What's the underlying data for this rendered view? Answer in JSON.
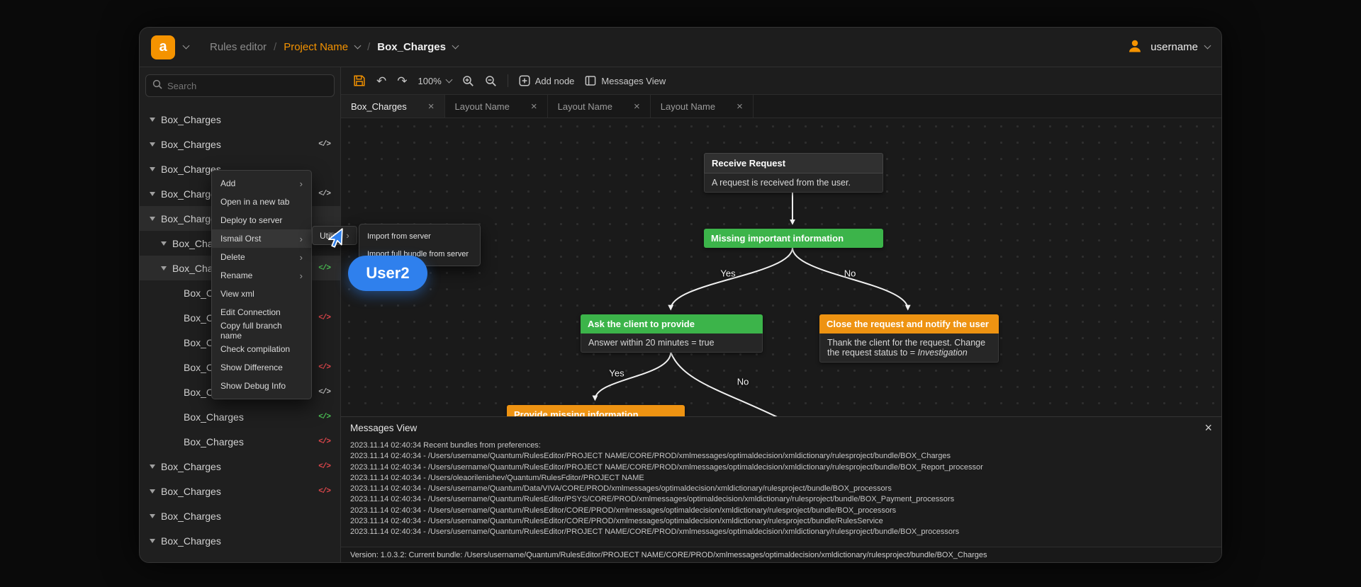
{
  "header": {
    "logo_text": "a",
    "breadcrumb": {
      "app": "Rules editor",
      "sep": "/",
      "project": "Project Name",
      "file": "Box_Charges"
    },
    "user": {
      "name": "username"
    }
  },
  "sidebar": {
    "search_placeholder": "Search",
    "tree": [
      {
        "label": "Box_Charges",
        "icon": "none"
      },
      {
        "label": "Box_Charges",
        "icon": "code-gray"
      },
      {
        "label": "Box_Charges",
        "icon": "none"
      },
      {
        "label": "Box_Charges",
        "icon": "code-gray"
      },
      {
        "label": "Box_Charges",
        "icon": "none",
        "selected": true
      },
      {
        "label": "Box_Charges",
        "icon": "none"
      },
      {
        "label": "Box_Charges",
        "icon": "code-green",
        "selected": true
      },
      {
        "label": "Box_Charges",
        "icon": "none"
      },
      {
        "label": "Box_Charges",
        "icon": "code-red"
      },
      {
        "label": "Box_Charges",
        "icon": "none"
      },
      {
        "label": "Box_Charges",
        "icon": "code-red"
      },
      {
        "label": "Box_Charges",
        "icon": "code-gray"
      },
      {
        "label": "Box_Charges",
        "icon": "code-green"
      },
      {
        "label": "Box_Charges",
        "icon": "code-red"
      },
      {
        "label": "Box_Charges",
        "icon": "code-red"
      },
      {
        "label": "Box_Charges",
        "icon": "code-red"
      },
      {
        "label": "Box_Charges",
        "icon": "none"
      },
      {
        "label": "Box_Charges",
        "icon": "none"
      }
    ]
  },
  "context_menu": {
    "items": [
      {
        "label": "Add",
        "has_submenu": true
      },
      {
        "label": "Open in a new tab"
      },
      {
        "label": "Deploy to server"
      },
      {
        "label": "Ismail Orst",
        "has_submenu": true,
        "active": true
      },
      {
        "label": "Delete",
        "has_submenu": true
      },
      {
        "label": "Rename",
        "has_submenu": true
      },
      {
        "label": "View xml"
      },
      {
        "label": "Edit Connection"
      },
      {
        "label": "Copy full branch name"
      },
      {
        "label": "Check compilation"
      },
      {
        "label": "Show Difference"
      },
      {
        "label": "Show Debug Info"
      }
    ],
    "utility_label": "Utility",
    "submenu_items": [
      "Import from server",
      "Import full bundle from server"
    ]
  },
  "collaborator": {
    "name": "User2",
    "color": "#2F80ED"
  },
  "toolbar": {
    "zoom_level": "100%",
    "add_node": "Add node",
    "messages_view": "Messages View"
  },
  "tabs": [
    {
      "label": "Box_Charges",
      "active": true
    },
    {
      "label": "Layout Name",
      "active": false
    },
    {
      "label": "Layout Name",
      "active": false
    },
    {
      "label": "Layout Name",
      "active": false
    }
  ],
  "canvas": {
    "nodes": {
      "receive": {
        "title": "Receive Request",
        "body": "A request is received from the user."
      },
      "missing": {
        "title": "Missing important information"
      },
      "ask": {
        "title": "Ask the client to provide",
        "body": "Answer within 20 minutes = true"
      },
      "close": {
        "title": "Close the request and notify the user",
        "body": "Thank the client for the request. Change the request status to = ",
        "body_em": "Investigation"
      },
      "provide": {
        "title": "Provide missing information"
      }
    },
    "edge_labels": {
      "l1": "Yes",
      "l2": "No",
      "l3": "Yes",
      "l4": "No"
    }
  },
  "messages": {
    "title": "Messages View",
    "lines": [
      "2023.11.14 02:40:34 Recent bundles from preferences:",
      "2023.11.14 02:40:34 - /Users/username/Quantum/RulesEditor/PROJECT NAME/CORE/PROD/xmlmessages/optimaldecision/xmldictionary/rulesproject/bundle/BOX_Charges",
      "2023.11.14 02:40:34 - /Users/username/Quantum/RulesEditor/PROJECT NAME/CORE/PROD/xmlmessages/optimaldecision/xmldictionary/rulesproject/bundle/BOX_Report_processor",
      "2023.11.14 02:40:34 - /Users/oleaorilenishev/Quantum/RulesFditor/PROJECT NAME",
      "2023.11.14 02:40:34 - /Users/username/Quantum/Data/VIVA/CORE/PROD/xmlmessages/optimaldecision/xmldictionary/rulesproject/bundle/BOX_processors",
      "2023.11.14 02:40:34 - /Users/username/Quantum/RulesEditor/PSYS/CORE/PROD/xmlmessages/optimaldecision/xmldictionary/rulesproject/bundle/BOX_Payment_processors",
      "2023.11.14 02:40:34 - /Users/username/Quantum/RulesEditor/CORE/PROD/xmlmessages/optimaldecision/xmldictionary/rulesproject/bundle/BOX_processors",
      "2023.11.14 02:40:34 - /Users/username/Quantum/RulesEditor/CORE/PROD/xmlmessages/optimaldecision/xmldictionary/rulesproject/bundle/RulesService",
      "2023.11.14 02:40:34 - /Users/username/Quantum/RulesEditor/PROJECT NAME/CORE/PROD/xmlmessages/optimaldecision/xmldictionary/rulesproject/bundle/BOX_processors"
    ],
    "version": "Version: 1.0.3.2: Current bundle: /Users/username/Quantum/RulesEditor/PROJECT NAME/CORE/PROD/xmlmessages/optimaldecision/xmldictionary/rulesproject/bundle/BOX_Charges"
  },
  "icons": {
    "close": "×",
    "code": "</>",
    "submenu_arrow": "›",
    "undo": "↶",
    "redo": "↷"
  }
}
